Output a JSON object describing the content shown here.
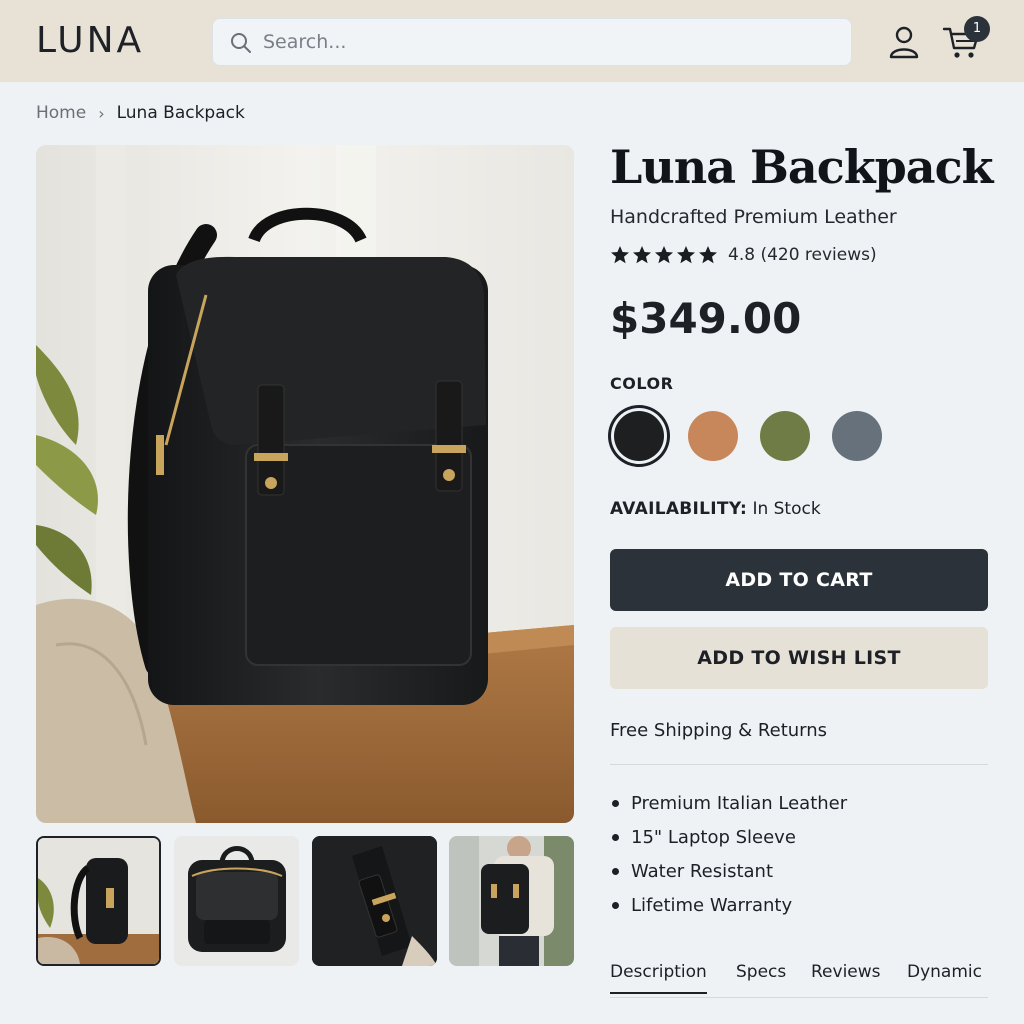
{
  "header": {
    "logo": "LUNA",
    "search": {
      "placeholder": "Search..."
    },
    "cart_count": "1"
  },
  "breadcrumb": {
    "home": "Home",
    "separator": "›",
    "current": "Luna Backpack"
  },
  "product": {
    "title": "Luna Backpack",
    "subtitle": "Handcrafted Premium Leather",
    "rating": {
      "value": 4.8,
      "stars": 5,
      "text": "4.8 (420 reviews)"
    },
    "price": "$349.00",
    "color_label": "COLOR",
    "colors": [
      {
        "name": "black",
        "hex": "#1e1f21",
        "selected": true
      },
      {
        "name": "tan",
        "hex": "#c8875a",
        "selected": false
      },
      {
        "name": "olive",
        "hex": "#707c45",
        "selected": false
      },
      {
        "name": "slate",
        "hex": "#66717c",
        "selected": false
      }
    ],
    "availability_label": "AVAILABILITY:",
    "availability_value": "In Stock",
    "add_to_cart": "ADD TO CART",
    "add_to_wishlist": "ADD TO WISH LIST",
    "shipping": "Free Shipping & Returns",
    "features": [
      "Premium Italian Leather",
      "15\" Laptop Sleeve",
      "Water Resistant",
      "Lifetime Warranty"
    ]
  },
  "tabs": [
    "Description",
    "Specs",
    "Reviews",
    "Dynamic"
  ],
  "active_tab": "Description",
  "colors": {
    "header_bg": "#e8e2d6",
    "primary_button": "#2b323a",
    "secondary_button": "#e6e1d6",
    "page_bg": "#eef2f5"
  }
}
